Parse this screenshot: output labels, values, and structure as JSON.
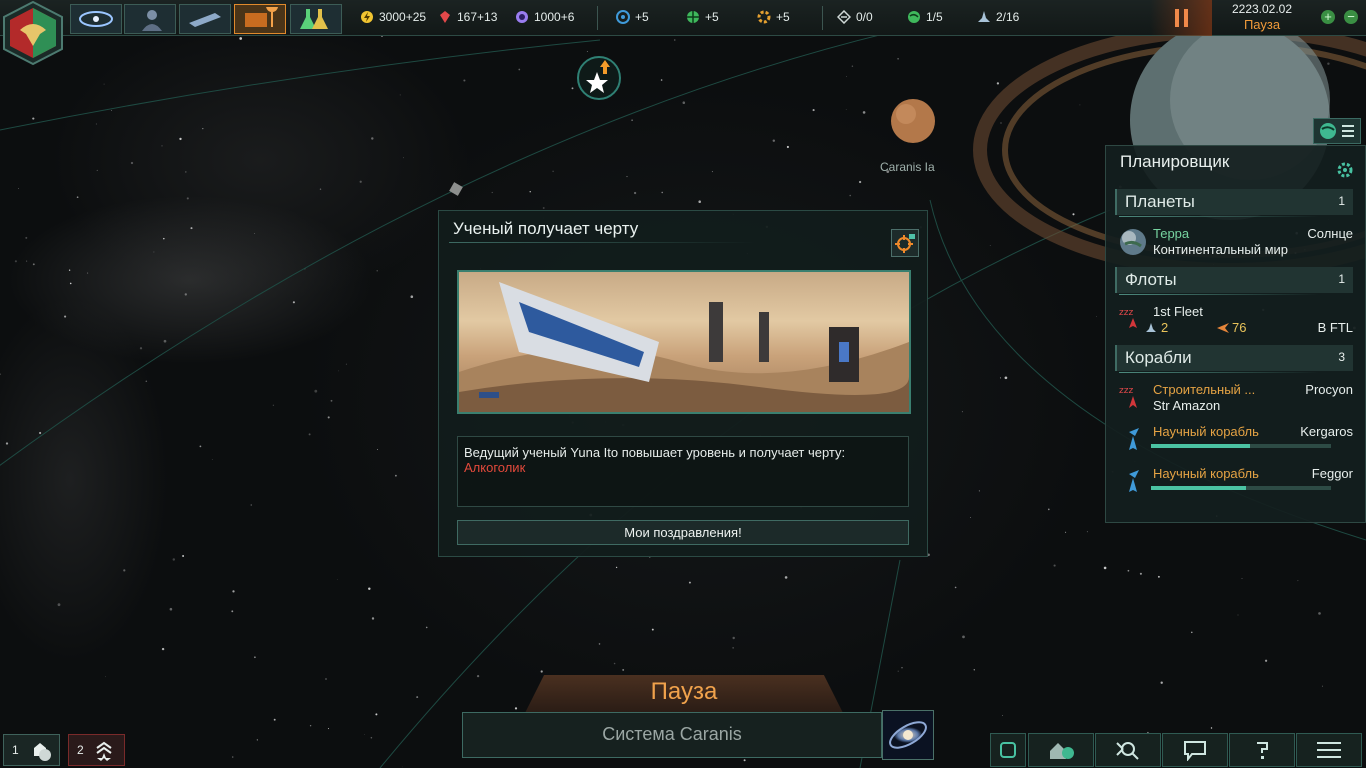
{
  "topbar": {
    "resources": [
      {
        "icon": "energy-icon",
        "value": "3000+25",
        "color": "#f2c531"
      },
      {
        "icon": "minerals-icon",
        "value": "167+13",
        "color": "#e2484a"
      },
      {
        "icon": "influence-icon",
        "value": "1000+6",
        "color": "#9a7df0"
      }
    ],
    "research": [
      {
        "icon": "physics-research-icon",
        "value": "+5",
        "color": "#3f9ad9"
      },
      {
        "icon": "society-research-icon",
        "value": "+5",
        "color": "#3fb85c"
      },
      {
        "icon": "engineering-research-icon",
        "value": "+5",
        "color": "#e5a030"
      }
    ],
    "counters": [
      {
        "icon": "outposts-icon",
        "value": "0/0"
      },
      {
        "icon": "planets-icon",
        "value": "1/5"
      },
      {
        "icon": "fleet-capacity-icon",
        "value": "2/16"
      }
    ],
    "date": "2223.02.02",
    "status": "Пауза"
  },
  "map": {
    "planet_label": "Caranis Ia"
  },
  "dialog": {
    "title": "Ученый получает черту",
    "text": "Ведущий ученый Yuna Ito повышает уровень и получает черту:",
    "trait": "Алкоголик",
    "button": "Мои поздравления!"
  },
  "outliner": {
    "title": "Планировщик",
    "planets": {
      "label": "Планеты",
      "count": "1"
    },
    "planet_row": {
      "name": "Терра",
      "system": "Солнце",
      "type": "Континентальный мир"
    },
    "fleets": {
      "label": "Флоты",
      "count": "1"
    },
    "fleet_row": {
      "name": "1st Fleet",
      "ships": "2",
      "power": "76",
      "state": "В FTL"
    },
    "ships": {
      "label": "Корабли",
      "count": "3"
    },
    "ship_rows": [
      {
        "name": "Строительный ...",
        "location": "Procyon",
        "sub": "Str Amazon",
        "progress": 0
      },
      {
        "name": "Научный корабль",
        "location": "Kergaros",
        "sub": "",
        "progress": 0.55
      },
      {
        "name": "Научный корабль",
        "location": "Feggor",
        "sub": "",
        "progress": 0.53
      }
    ]
  },
  "bottom": {
    "pause": "Пауза",
    "system": "Система Caranis",
    "left_buttons": [
      {
        "count": "1"
      },
      {
        "count": "2"
      }
    ]
  }
}
